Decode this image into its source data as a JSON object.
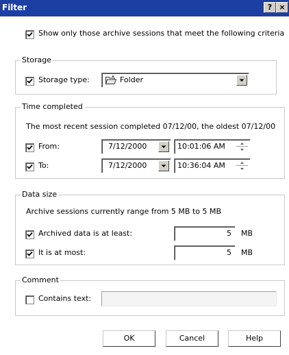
{
  "window": {
    "title": "Filter",
    "help_button": "?",
    "close_button": "×"
  },
  "criteria": {
    "label": "Show only those archive sessions that meet the following criteria",
    "checked": true
  },
  "storage": {
    "group_label": "Storage",
    "type_label": "Storage type:",
    "type_checked": true,
    "selected": "Folder",
    "icon": "folder-icon"
  },
  "time": {
    "group_label": "Time completed",
    "info": "The most recent session completed 07/12/00, the oldest 07/12/00",
    "from_label": "From:",
    "from_checked": true,
    "from_date": "7/12/2000",
    "from_time": "10:01:06 AM",
    "to_label": "To:",
    "to_checked": true,
    "to_date": "7/12/2000",
    "to_time": "10:36:04 AM"
  },
  "size": {
    "group_label": "Data size",
    "info": "Archive sessions currently range from 5 MB to 5 MB",
    "least_label": "Archived data is at least:",
    "least_checked": true,
    "least_value": "5",
    "least_unit": "MB",
    "most_label": "It is at most:",
    "most_checked": true,
    "most_value": "5",
    "most_unit": "MB"
  },
  "comment": {
    "group_label": "Comment",
    "contains_label": "Contains text:",
    "contains_checked": false,
    "text_value": ""
  },
  "buttons": {
    "ok": "OK",
    "cancel": "Cancel",
    "help": "Help"
  }
}
